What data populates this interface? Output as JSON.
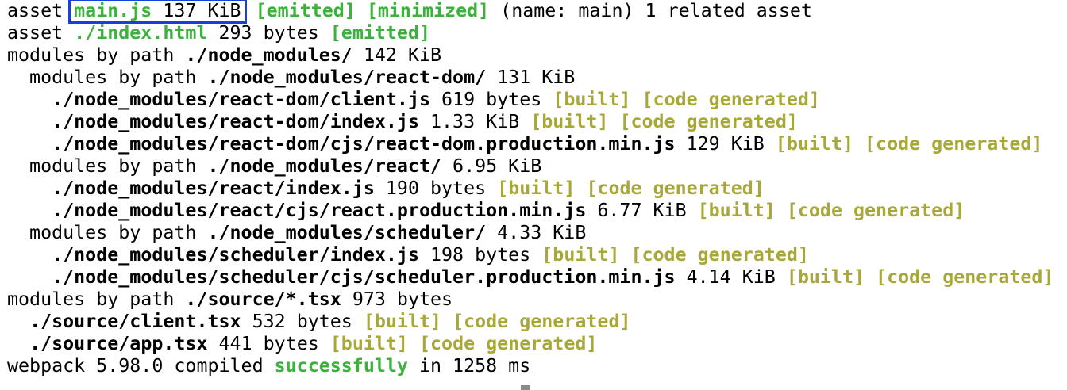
{
  "terminal": {
    "lines": [
      {
        "id": "asset-main",
        "parts": [
          {
            "t": "asset ",
            "s": "plain"
          },
          {
            "t": "main.js",
            "s": "green",
            "box": true
          },
          {
            "t": " 137 KiB",
            "s": "plain",
            "box": true
          },
          {
            "t": " ",
            "s": "plain"
          },
          {
            "t": "[emitted]",
            "s": "green"
          },
          {
            "t": " ",
            "s": "plain"
          },
          {
            "t": "[minimized]",
            "s": "green"
          },
          {
            "t": " (name: main) 1 related asset",
            "s": "plain"
          }
        ]
      },
      {
        "id": "asset-index",
        "parts": [
          {
            "t": "asset ",
            "s": "plain"
          },
          {
            "t": "./index.html",
            "s": "green"
          },
          {
            "t": " 293 bytes ",
            "s": "plain"
          },
          {
            "t": "[emitted]",
            "s": "green"
          }
        ]
      },
      {
        "id": "modules-node-modules",
        "parts": [
          {
            "t": "modules by path ",
            "s": "plain"
          },
          {
            "t": "./node_modules/",
            "s": "bold"
          },
          {
            "t": " 142 KiB",
            "s": "plain"
          }
        ]
      },
      {
        "id": "modules-react-dom",
        "parts": [
          {
            "t": "  modules by path ",
            "s": "plain"
          },
          {
            "t": "./node_modules/react-dom/",
            "s": "bold"
          },
          {
            "t": " 131 KiB",
            "s": "plain"
          }
        ]
      },
      {
        "id": "react-dom-client",
        "parts": [
          {
            "t": "    ",
            "s": "plain"
          },
          {
            "t": "./node_modules/react-dom/client.js",
            "s": "bold"
          },
          {
            "t": " 619 bytes ",
            "s": "plain"
          },
          {
            "t": "[built]",
            "s": "olive"
          },
          {
            "t": " ",
            "s": "plain"
          },
          {
            "t": "[code generated]",
            "s": "olive"
          }
        ]
      },
      {
        "id": "react-dom-index",
        "parts": [
          {
            "t": "    ",
            "s": "plain"
          },
          {
            "t": "./node_modules/react-dom/index.js",
            "s": "bold"
          },
          {
            "t": " 1.33 KiB ",
            "s": "plain"
          },
          {
            "t": "[built]",
            "s": "olive"
          },
          {
            "t": " ",
            "s": "plain"
          },
          {
            "t": "[code generated]",
            "s": "olive"
          }
        ]
      },
      {
        "id": "react-dom-prod",
        "parts": [
          {
            "t": "    ",
            "s": "plain"
          },
          {
            "t": "./node_modules/react-dom/cjs/react-dom.production.min.js",
            "s": "bold"
          },
          {
            "t": " 129 KiB ",
            "s": "plain"
          },
          {
            "t": "[built]",
            "s": "olive"
          },
          {
            "t": " ",
            "s": "plain"
          },
          {
            "t": "[code generated]",
            "s": "olive"
          }
        ]
      },
      {
        "id": "modules-react",
        "parts": [
          {
            "t": "  modules by path ",
            "s": "plain"
          },
          {
            "t": "./node_modules/react/",
            "s": "bold"
          },
          {
            "t": " 6.95 KiB",
            "s": "plain"
          }
        ]
      },
      {
        "id": "react-index",
        "parts": [
          {
            "t": "    ",
            "s": "plain"
          },
          {
            "t": "./node_modules/react/index.js",
            "s": "bold"
          },
          {
            "t": " 190 bytes ",
            "s": "plain"
          },
          {
            "t": "[built]",
            "s": "olive"
          },
          {
            "t": " ",
            "s": "plain"
          },
          {
            "t": "[code generated]",
            "s": "olive"
          }
        ]
      },
      {
        "id": "react-prod",
        "parts": [
          {
            "t": "    ",
            "s": "plain"
          },
          {
            "t": "./node_modules/react/cjs/react.production.min.js",
            "s": "bold"
          },
          {
            "t": " 6.77 KiB ",
            "s": "plain"
          },
          {
            "t": "[built]",
            "s": "olive"
          },
          {
            "t": " ",
            "s": "plain"
          },
          {
            "t": "[code generated]",
            "s": "olive"
          }
        ]
      },
      {
        "id": "modules-scheduler",
        "parts": [
          {
            "t": "  modules by path ",
            "s": "plain"
          },
          {
            "t": "./node_modules/scheduler/",
            "s": "bold"
          },
          {
            "t": " 4.33 KiB",
            "s": "plain"
          }
        ]
      },
      {
        "id": "scheduler-index",
        "parts": [
          {
            "t": "    ",
            "s": "plain"
          },
          {
            "t": "./node_modules/scheduler/index.js",
            "s": "bold"
          },
          {
            "t": " 198 bytes ",
            "s": "plain"
          },
          {
            "t": "[built]",
            "s": "olive"
          },
          {
            "t": " ",
            "s": "plain"
          },
          {
            "t": "[code generated]",
            "s": "olive"
          }
        ]
      },
      {
        "id": "scheduler-prod",
        "parts": [
          {
            "t": "    ",
            "s": "plain"
          },
          {
            "t": "./node_modules/scheduler/cjs/scheduler.production.min.js",
            "s": "bold"
          },
          {
            "t": " 4.14 KiB ",
            "s": "plain"
          },
          {
            "t": "[built]",
            "s": "olive"
          },
          {
            "t": " ",
            "s": "plain"
          },
          {
            "t": "[code generated]",
            "s": "olive"
          }
        ]
      },
      {
        "id": "modules-source",
        "parts": [
          {
            "t": "modules by path ",
            "s": "plain"
          },
          {
            "t": "./source/*.tsx",
            "s": "bold"
          },
          {
            "t": " 973 bytes",
            "s": "plain"
          }
        ]
      },
      {
        "id": "source-client",
        "parts": [
          {
            "t": "  ",
            "s": "plain"
          },
          {
            "t": "./source/client.tsx",
            "s": "bold"
          },
          {
            "t": " 532 bytes ",
            "s": "plain"
          },
          {
            "t": "[built]",
            "s": "olive"
          },
          {
            "t": " ",
            "s": "plain"
          },
          {
            "t": "[code generated]",
            "s": "olive"
          }
        ]
      },
      {
        "id": "source-app",
        "parts": [
          {
            "t": "  ",
            "s": "plain"
          },
          {
            "t": "./source/app.tsx",
            "s": "bold"
          },
          {
            "t": " 441 bytes ",
            "s": "plain"
          },
          {
            "t": "[built]",
            "s": "olive"
          },
          {
            "t": " ",
            "s": "plain"
          },
          {
            "t": "[code generated]",
            "s": "olive"
          }
        ]
      },
      {
        "id": "compiled",
        "parts": [
          {
            "t": "webpack 5.98.0 compiled ",
            "s": "plain"
          },
          {
            "t": "successfully",
            "s": "green"
          },
          {
            "t": " in 1258 ms",
            "s": "plain"
          }
        ]
      }
    ]
  },
  "colors": {
    "green": "#3cb13c",
    "olive": "#a8a838",
    "highlight_box": "#1a3fd6",
    "cursor": "#8a8a8a"
  },
  "icons": {
    "cursor": "terminal-cursor-block"
  }
}
